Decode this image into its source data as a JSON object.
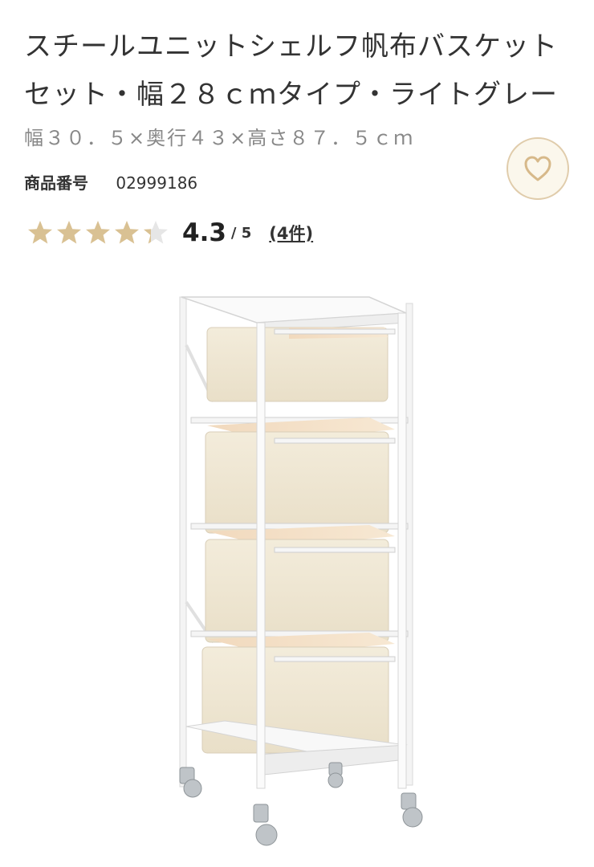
{
  "product": {
    "title_line1": "スチールユニットシェルフ帆布バスケット",
    "title_line2": "セット・幅２８ｃｍタイプ・ライトグレー",
    "dimensions": "幅３０．５×奥行４３×高さ８７．５ｃｍ",
    "product_number_label": "商品番号",
    "product_number": "02999186"
  },
  "rating": {
    "value": "4.3",
    "max": "/ 5",
    "review_count": "(4件)",
    "score": 4.3,
    "star_count": 5
  },
  "colors": {
    "star_filled": "#d9c193",
    "star_empty": "#e6e6e6",
    "favorite_border": "#e0ccab",
    "favorite_bg": "#fbf7ec",
    "canvas": "#efe6d2"
  },
  "icons": {
    "favorite": "heart-outline-icon",
    "star": "star-icon"
  }
}
